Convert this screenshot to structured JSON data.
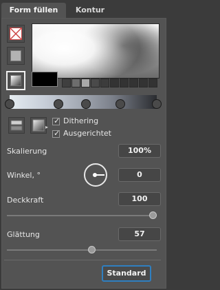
{
  "tabs": [
    {
      "label": "Form füllen",
      "active": true
    },
    {
      "label": "Kontur",
      "active": false
    }
  ],
  "fill_modes": [
    {
      "name": "none",
      "icon": "no-fill-icon"
    },
    {
      "name": "solid",
      "icon": "solid-fill-icon"
    },
    {
      "name": "gradient",
      "icon": "gradient-fill-icon",
      "selected": true
    }
  ],
  "current_color": "#000000",
  "swatch_colors": [
    "#3f3f3f",
    "#6d6d6d",
    "#a9a9a9",
    "#4a4a4a",
    "#3c3c3c",
    "#333333",
    "#333333",
    "#333333",
    "#333333",
    "#333333"
  ],
  "gradient": {
    "colors": [
      "#e4ebf0",
      "#c5ccd6",
      "#a0a6b0",
      "#7b808a",
      "#2a2c30"
    ],
    "stops": [
      0,
      0.33,
      0.52,
      0.75,
      1
    ]
  },
  "options": {
    "dithering_label": "Dithering",
    "dithering_checked": true,
    "aligned_label": "Ausgerichtet",
    "aligned_checked": true
  },
  "scale": {
    "label": "Skalierung",
    "value": "100%"
  },
  "angle": {
    "label": "Winkel, °",
    "value": "0"
  },
  "opacity": {
    "label": "Deckkraft",
    "value": "100",
    "level": 1.0
  },
  "smoothing": {
    "label": "Glättung",
    "value": "57",
    "level": 0.57
  },
  "standard_button": "Standard"
}
